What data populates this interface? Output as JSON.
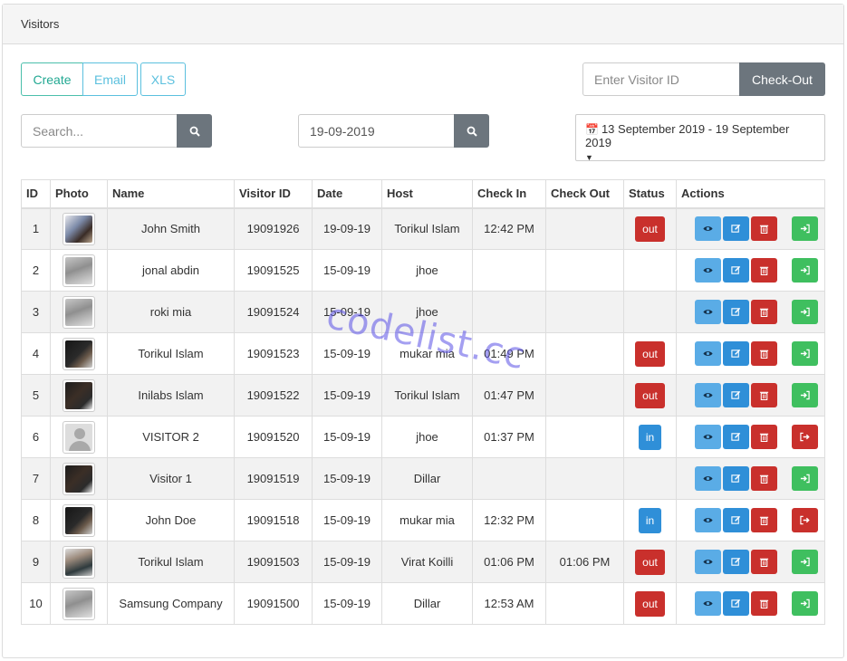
{
  "panel": {
    "title": "Visitors"
  },
  "toolbar": {
    "create_label": "Create",
    "email_label": "Email",
    "xls_label": "XLS",
    "visitor_id_placeholder": "Enter Visitor ID",
    "checkout_label": "Check-Out",
    "search_placeholder": "Search...",
    "date_value": "19-09-2019",
    "date_range": "13 September 2019 - 19 September 2019"
  },
  "table": {
    "headers": {
      "id": "ID",
      "photo": "Photo",
      "name": "Name",
      "visitor_id": "Visitor ID",
      "date": "Date",
      "host": "Host",
      "check_in": "Check In",
      "check_out": "Check Out",
      "status": "Status",
      "actions": "Actions"
    },
    "rows": [
      {
        "id": "1",
        "photo": "photo-a",
        "name": "John Smith",
        "visitor_id": "19091926",
        "date": "19-09-19",
        "host": "Torikul Islam",
        "check_in": "12:42 PM",
        "check_out": "",
        "status": "out",
        "action": "checkin"
      },
      {
        "id": "2",
        "photo": "photo-b",
        "name": "jonal abdin",
        "visitor_id": "19091525",
        "date": "15-09-19",
        "host": "jhoe",
        "check_in": "",
        "check_out": "",
        "status": "",
        "action": "checkin"
      },
      {
        "id": "3",
        "photo": "photo-b",
        "name": "roki mia",
        "visitor_id": "19091524",
        "date": "15-09-19",
        "host": "jhoe",
        "check_in": "",
        "check_out": "",
        "status": "",
        "action": "checkin"
      },
      {
        "id": "4",
        "photo": "photo-c",
        "name": "Torikul Islam",
        "visitor_id": "19091523",
        "date": "15-09-19",
        "host": "mukar mia",
        "check_in": "01:49 PM",
        "check_out": "",
        "status": "out",
        "action": "checkin"
      },
      {
        "id": "5",
        "photo": "photo-d",
        "name": "Inilabs Islam",
        "visitor_id": "19091522",
        "date": "15-09-19",
        "host": "Torikul Islam",
        "check_in": "01:47 PM",
        "check_out": "",
        "status": "out",
        "action": "checkin"
      },
      {
        "id": "6",
        "photo": "avatar-default",
        "name": "VISITOR 2",
        "visitor_id": "19091520",
        "date": "15-09-19",
        "host": "jhoe",
        "check_in": "01:37 PM",
        "check_out": "",
        "status": "in",
        "action": "checkout"
      },
      {
        "id": "7",
        "photo": "photo-d",
        "name": "Visitor 1",
        "visitor_id": "19091519",
        "date": "15-09-19",
        "host": "Dillar",
        "check_in": "",
        "check_out": "",
        "status": "",
        "action": "checkin"
      },
      {
        "id": "8",
        "photo": "photo-c",
        "name": "John Doe",
        "visitor_id": "19091518",
        "date": "15-09-19",
        "host": "mukar mia",
        "check_in": "12:32 PM",
        "check_out": "",
        "status": "in",
        "action": "checkout"
      },
      {
        "id": "9",
        "photo": "photo-e",
        "name": "Torikul Islam",
        "visitor_id": "19091503",
        "date": "15-09-19",
        "host": "Virat Koilli",
        "check_in": "01:06 PM",
        "check_out": "01:06 PM",
        "status": "out",
        "action": "checkin"
      },
      {
        "id": "10",
        "photo": "photo-b",
        "name": "Samsung Company",
        "visitor_id": "19091500",
        "date": "15-09-19",
        "host": "Dillar",
        "check_in": "12:53 AM",
        "check_out": "",
        "status": "out",
        "action": "checkin"
      }
    ]
  },
  "icons": {
    "search": "search-icon",
    "calendar": "calendar-icon",
    "caret": "caret-down-icon",
    "view": "eye-icon",
    "edit": "edit-icon",
    "delete": "trash-icon",
    "checkin": "sign-in-icon",
    "checkout": "sign-out-icon"
  },
  "colors": {
    "status_out": "#c9302c",
    "status_in": "#2f8fd8",
    "view": "#5aace6",
    "edit": "#2f8fd8",
    "delete": "#c9302c",
    "checkin": "#3fbf5f",
    "primary_outline": "#5bc0de",
    "dark_button": "#6c757d"
  },
  "watermark": "codelist.cc"
}
